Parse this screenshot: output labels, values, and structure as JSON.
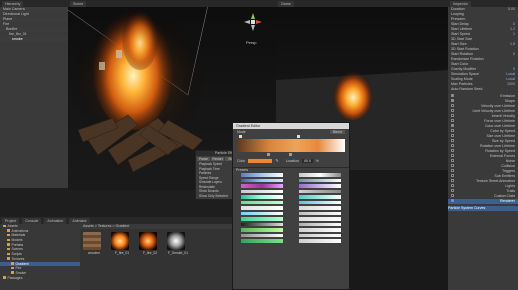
{
  "hierarchy": {
    "tab": "Hierarchy",
    "items": [
      "Main Camera",
      "Directional Light",
      "Plane",
      "Fire",
      "Bonfire",
      "fire_fbx_01",
      "smoke"
    ]
  },
  "scene": {
    "tab_scene": "Scene",
    "tab_game": "Game",
    "gizmo_label": "Persp"
  },
  "game": {
    "tab": "Game"
  },
  "inspector": {
    "tab": "Inspector",
    "rows": [
      {
        "l": "Duration",
        "v": "5.00"
      },
      {
        "l": "Looping",
        "v": ""
      },
      {
        "l": "Prewarm",
        "v": ""
      },
      {
        "l": "Start Delay",
        "v": "0"
      },
      {
        "l": "Start Lifetime",
        "v": "1.2"
      },
      {
        "l": "Start Speed",
        "v": "1"
      },
      {
        "l": "3D Start Size",
        "v": ""
      },
      {
        "l": "Start Size",
        "v": "1.5"
      },
      {
        "l": "3D Start Rotation",
        "v": ""
      },
      {
        "l": "Start Rotation",
        "v": "0"
      },
      {
        "l": "Randomize Rotation",
        "v": ""
      },
      {
        "l": "Start Color",
        "v": ""
      },
      {
        "l": "Gravity Modifier",
        "v": "0"
      },
      {
        "l": "Simulation Space",
        "v": "Local"
      },
      {
        "l": "Scaling Mode",
        "v": "Local"
      },
      {
        "l": "Max Particles",
        "v": "1000"
      },
      {
        "l": "Auto Random Seed",
        "v": ""
      }
    ],
    "modules": [
      "Emission",
      "Shape",
      "Velocity over Lifetime",
      "Limit Velocity over Lifetime",
      "Inherit Velocity",
      "Force over Lifetime",
      "Color over Lifetime",
      "Color by Speed",
      "Size over Lifetime",
      "Size by Speed",
      "Rotation over Lifetime",
      "Rotation by Speed",
      "External Forces",
      "Noise",
      "Collision",
      "Triggers",
      "Sub Emitters",
      "Texture Sheet Animation",
      "Lights",
      "Trails",
      "Custom Data",
      "Renderer"
    ],
    "footer": [
      "Resimulate",
      "Show Bounds"
    ],
    "curves_label": "Particle System Curves"
  },
  "overlay": {
    "title": "Particle Effect",
    "buttons": [
      "Pause",
      "Restart",
      "Stop"
    ],
    "rows": [
      "Playback Speed",
      "Playback Time",
      "Particles",
      "Speed Range",
      "Simulate Layers",
      "Resimulate",
      "Show Bounds",
      "Show Only Selected"
    ]
  },
  "gradient_editor": {
    "title": "Gradient Editor",
    "mode_label": "Mode",
    "mode_value": "Blend",
    "color_label": "Color",
    "location_label": "Location",
    "location_value": "68.8",
    "percent": "%",
    "presets_label": "Presets"
  },
  "project": {
    "tabs": [
      "Project",
      "Console",
      "Animation",
      "Animator"
    ],
    "breadcrumb": "Assets > Textures > Gradient",
    "tree": [
      "Assets",
      "Animations",
      "Materials",
      "Models",
      "Prefabs",
      "Scenes",
      "Scripts",
      "Textures",
      "Gradient",
      "Fire",
      "Smoke",
      "Packages"
    ],
    "assets": [
      "wooden",
      "F_fire_01",
      "F_fire_02",
      "F_Smoke_01"
    ]
  },
  "colors": {
    "accent": "#3d5f8f",
    "fire": "#f08a20"
  }
}
